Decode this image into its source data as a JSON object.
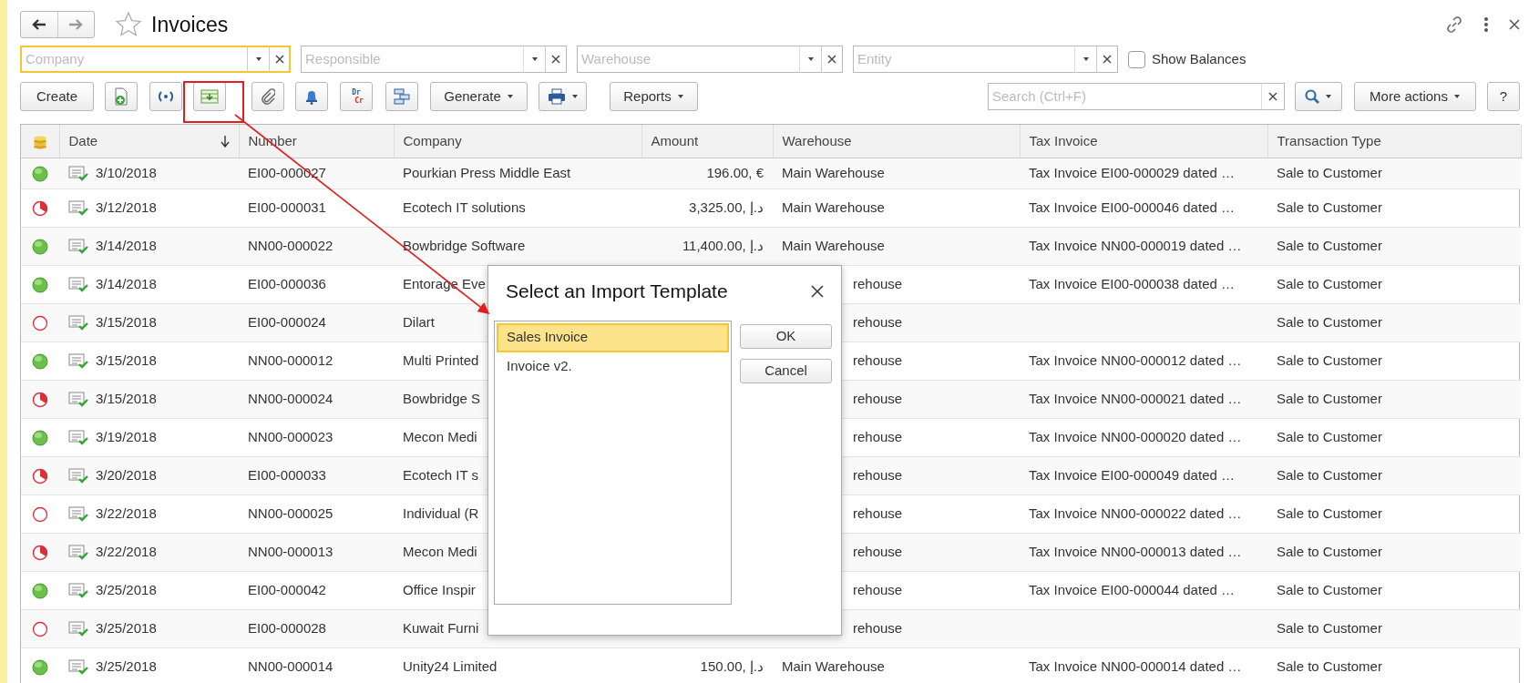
{
  "window": {
    "title": "Invoices"
  },
  "filters": [
    {
      "placeholder": "Company",
      "focused": true
    },
    {
      "placeholder": "Responsible",
      "focused": false
    },
    {
      "placeholder": "Warehouse",
      "focused": false
    },
    {
      "placeholder": "Entity",
      "focused": false
    }
  ],
  "show_balances": {
    "label": "Show Balances",
    "checked": false
  },
  "toolbar": {
    "create": "Create",
    "drcr": {
      "top": "Dr",
      "bottom": "Cr"
    },
    "generate": "Generate",
    "reports": "Reports",
    "search_placeholder": "Search (Ctrl+F)",
    "more_actions": "More actions",
    "help": "?"
  },
  "table": {
    "columns": [
      "Date",
      "Number",
      "Company",
      "Amount",
      "Warehouse",
      "Tax Invoice",
      "Transaction Type"
    ],
    "rows": [
      {
        "kind": "full",
        "date": "3/10/2018",
        "number": "EI00-000027",
        "company": "Pourkian Press Middle East",
        "amount": "196.00, €",
        "warehouse": "Main Warehouse",
        "tax_invoice": "Tax Invoice EI00-000029 dated …",
        "transaction_type": "Sale to Customer"
      },
      {
        "kind": "partial",
        "date": "3/12/2018",
        "number": "EI00-000031",
        "company": "Ecotech IT solutions",
        "amount": "3,325.00, د.إ",
        "warehouse": "Main Warehouse",
        "tax_invoice": "Tax Invoice EI00-000046 dated …",
        "transaction_type": "Sale to Customer"
      },
      {
        "kind": "full",
        "date": "3/14/2018",
        "number": "NN00-000022",
        "company": "Bowbridge Software",
        "amount": "11,400.00, د.إ",
        "warehouse": "Main Warehouse",
        "tax_invoice": "Tax Invoice NN00-000019 dated …",
        "transaction_type": "Sale to Customer"
      },
      {
        "kind": "full",
        "date": "3/14/2018",
        "number": "EI00-000036",
        "company": "Entorage Eve",
        "warehouse": "rehouse",
        "tax_invoice": "Tax Invoice EI00-000038 dated …",
        "transaction_type": "Sale to Customer"
      },
      {
        "kind": "empty",
        "date": "3/15/2018",
        "number": "EI00-000024",
        "company": "Dilart",
        "warehouse": "rehouse",
        "transaction_type": "Sale to Customer"
      },
      {
        "kind": "full",
        "date": "3/15/2018",
        "number": "NN00-000012",
        "company": "Multi Printed",
        "warehouse": "rehouse",
        "tax_invoice": "Tax Invoice NN00-000012 dated …",
        "transaction_type": "Sale to Customer"
      },
      {
        "kind": "partial",
        "date": "3/15/2018",
        "number": "NN00-000024",
        "company": "Bowbridge S",
        "warehouse": "rehouse",
        "tax_invoice": "Tax Invoice NN00-000021 dated …",
        "transaction_type": "Sale to Customer"
      },
      {
        "kind": "full",
        "date": "3/19/2018",
        "number": "NN00-000023",
        "company": "Mecon Medi",
        "warehouse": "rehouse",
        "tax_invoice": "Tax Invoice NN00-000020 dated …",
        "transaction_type": "Sale to Customer"
      },
      {
        "kind": "partial",
        "date": "3/20/2018",
        "number": "EI00-000033",
        "company": "Ecotech IT s",
        "warehouse": "rehouse",
        "tax_invoice": "Tax Invoice EI00-000049 dated …",
        "transaction_type": "Sale to Customer"
      },
      {
        "kind": "empty",
        "date": "3/22/2018",
        "number": "NN00-000025",
        "company": "Individual (R",
        "warehouse": "rehouse",
        "tax_invoice": "Tax Invoice NN00-000022 dated …",
        "transaction_type": "Sale to Customer"
      },
      {
        "kind": "partial",
        "date": "3/22/2018",
        "number": "NN00-000013",
        "company": "Mecon Medi",
        "warehouse": "rehouse",
        "tax_invoice": "Tax Invoice NN00-000013 dated …",
        "transaction_type": "Sale to Customer"
      },
      {
        "kind": "full",
        "date": "3/25/2018",
        "number": "EI00-000042",
        "company": "Office Inspir",
        "warehouse": "rehouse",
        "tax_invoice": "Tax Invoice EI00-000044 dated …",
        "transaction_type": "Sale to Customer"
      },
      {
        "kind": "empty",
        "date": "3/25/2018",
        "number": "EI00-000028",
        "company": "Kuwait Furni",
        "warehouse": "rehouse",
        "transaction_type": "Sale to Customer"
      },
      {
        "kind": "full",
        "date": "3/25/2018",
        "number": "NN00-000014",
        "company": "Unity24 Limited",
        "amount": "150.00, د.إ",
        "warehouse": "Main Warehouse",
        "tax_invoice": "Tax Invoice NN00-000014 dated …",
        "transaction_type": "Sale to Customer"
      }
    ]
  },
  "dialog": {
    "title": "Select an Import Template",
    "items": [
      {
        "label": "Sales Invoice",
        "selected": true
      },
      {
        "label": "Invoice v2.",
        "selected": false
      }
    ],
    "buttons": [
      "OK",
      "Cancel"
    ]
  }
}
